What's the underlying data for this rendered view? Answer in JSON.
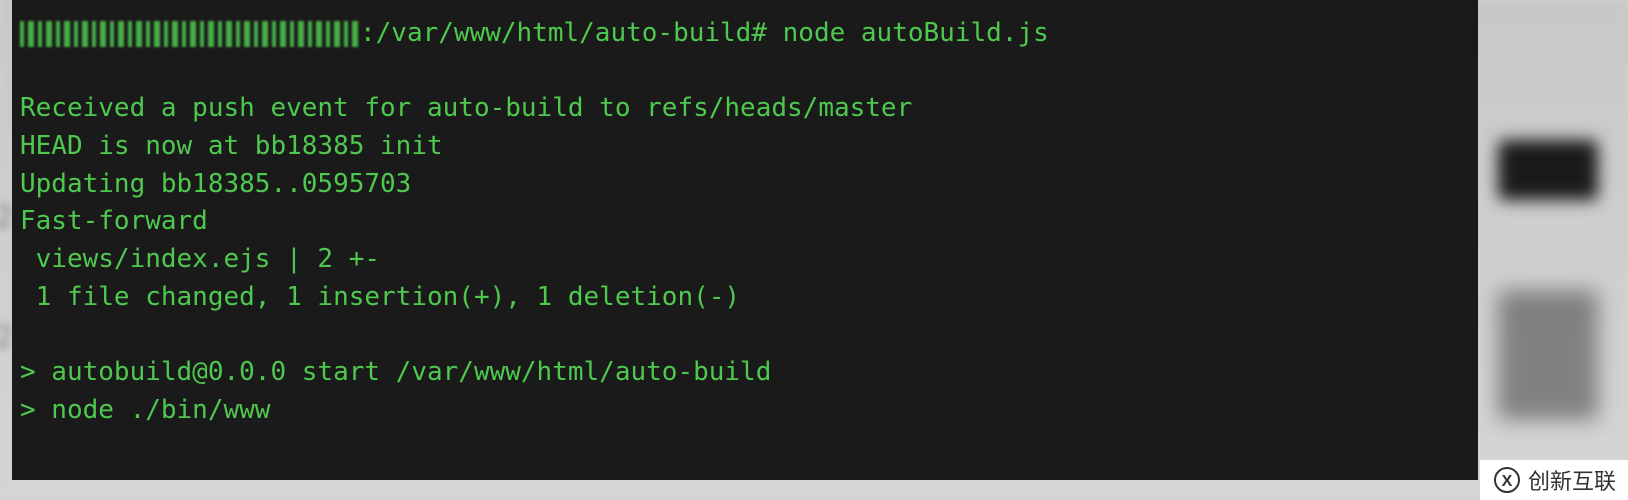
{
  "terminal": {
    "prompt_obscured": "████████████████████████",
    "prompt_path": ":/var/www/html/auto-build# node autoBuild.js",
    "lines": [
      "",
      "Received a push event for auto-build to refs/heads/master",
      "HEAD is now at bb18385 init",
      "Updating bb18385..0595703",
      "Fast-forward",
      " views/index.ejs | 2 +-",
      " 1 file changed, 1 insertion(+), 1 deletion(-)",
      "",
      "> autobuild@0.0.0 start /var/www/html/auto-build",
      "> node ./bin/www"
    ]
  },
  "watermark": {
    "text": "创新互联"
  }
}
